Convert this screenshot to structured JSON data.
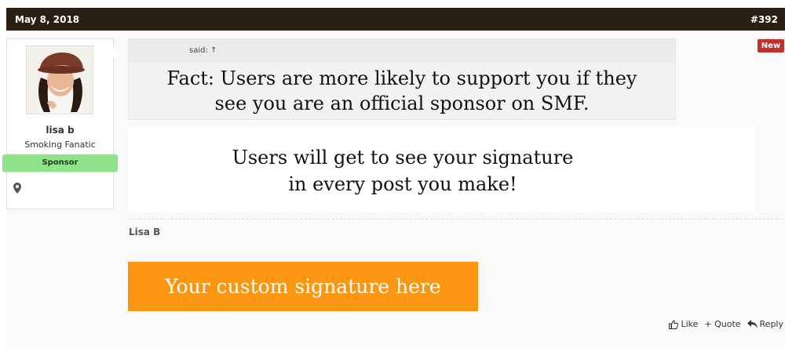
{
  "post": {
    "date": "May 8, 2018",
    "number": "#392",
    "new_badge": "New"
  },
  "author": {
    "username": "lisa b",
    "title": "Smoking Fanatic",
    "badge": "Sponsor",
    "location_icon": "map-marker-icon"
  },
  "quote": {
    "header": "said: ↑",
    "text": "Fact: Users are more likely to support you if they see you are an official sponsor on SMF."
  },
  "message": {
    "text": "Users will get to see your signature in every post you make!"
  },
  "signature": {
    "name": "Lisa B",
    "banner_text": "Your custom signature here",
    "banner_color": "#fb9613"
  },
  "actions": {
    "like": "Like",
    "quote": "+ Quote",
    "reply": "Reply"
  },
  "colors": {
    "header_bg": "#2b1f14",
    "new_badge_bg": "#c1322a",
    "sponsor_badge_bg": "#8fe38a"
  }
}
